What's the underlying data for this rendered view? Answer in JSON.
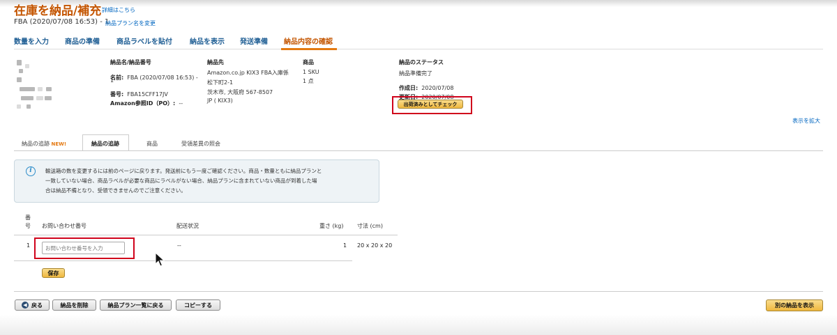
{
  "header": {
    "title": "在庫を納品/補充",
    "details_link": "詳細はこちら",
    "subtitle": "FBA (2020/07/08 16:53) - 1",
    "rename_link": "納品プラン名を変更"
  },
  "steps": [
    "数量を入力",
    "商品の準備",
    "商品ラベルを貼付",
    "納品を表示",
    "発送準備",
    "納品内容の確認"
  ],
  "active_step": "納品内容の確認",
  "summary": {
    "name_col": {
      "heading": "納品名/納品番号",
      "name_label": "名前:",
      "name_value_1": "FBA (2020/07/08 16:53) -",
      "name_value_2": "1",
      "number_label": "番号:",
      "number_value": "FBA15CFF17JV",
      "po_label": "Amazon参照ID（PO）:",
      "po_value": "--"
    },
    "destination_col": {
      "heading": "納品先",
      "lines": [
        "Amazon.co.jp KIX3 FBA入庫係",
        "松下町2-1",
        "茨木市, 大阪府 567-8507",
        "JP ( KIX3)"
      ]
    },
    "product_col": {
      "heading": "商品",
      "lines": [
        "1 SKU",
        "1 点"
      ]
    },
    "status_col": {
      "heading": "納品のステータス",
      "status": "納品準備完了",
      "created_label": "作成日:",
      "created_value": "2020/07/08",
      "updated_label": "更新日:",
      "updated_value": "2020/07/08",
      "mark_shipped_button": "出荷済みとしてチェック"
    }
  },
  "expand_link": "表示を拡大",
  "tabs": {
    "tracking_new": "納品の追跡",
    "new_badge": "NEW!",
    "tracking": "納品の追跡",
    "products": "商品",
    "reconcile": "受領差異の照会"
  },
  "info": {
    "line1": "輸送箱の数を変更するには前のページに戻ります。発送前にもう一度ご確認ください。商品・数量ともに納品プランと",
    "line2": "一致していない場合、商品ラベルが必要な商品にラベルがない場合、納品プランに含まれていない商品が到着した場",
    "line3": "合は納品不備となり、受領できませんのでご注意ください。"
  },
  "table": {
    "col_number_1": "番",
    "col_number_2": "号",
    "col_tracking": "お問い合わせ番号",
    "col_status": "配送状況",
    "col_weight": "重さ (kg)",
    "col_dims": "寸法 (cm)",
    "rows": [
      {
        "number": "1",
        "tracking_placeholder": "お問い合わせ番号を入力",
        "status": "--",
        "weight": "1",
        "dims": "20 x 20 x 20"
      }
    ],
    "save_button": "保存"
  },
  "footer": {
    "back": "戻る",
    "delete": "納品を削除",
    "back_to_plans": "納品プラン一覧に戻る",
    "copy": "コピーする",
    "show_other": "別の納品を表示"
  },
  "colors": {
    "title": "#c45500",
    "link": "#0066c0",
    "step": "#1f5e94",
    "highlight_box": "#d0021b",
    "yellow_button": "#efb73e"
  }
}
